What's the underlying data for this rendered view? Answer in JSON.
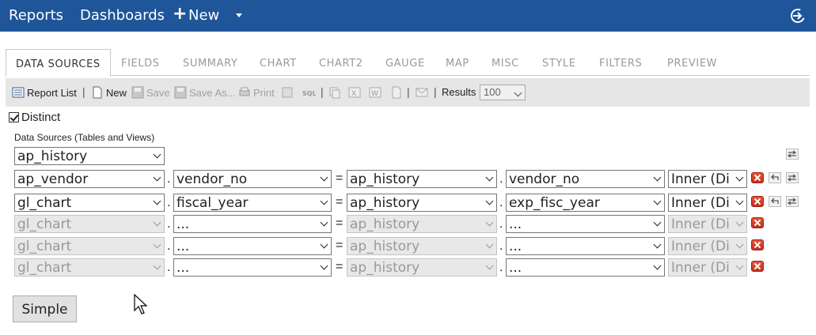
{
  "nav": {
    "reports": "Reports",
    "dashboards": "Dashboards",
    "new_label": "New",
    "brand_color": "#1f5599"
  },
  "tabs": [
    {
      "label": "DATA SOURCES",
      "active": true
    },
    {
      "label": "FIELDS"
    },
    {
      "label": "SUMMARY"
    },
    {
      "label": "CHART"
    },
    {
      "label": "CHART2"
    },
    {
      "label": "GAUGE"
    },
    {
      "label": "MAP"
    },
    {
      "label": "MISC"
    },
    {
      "label": "STYLE"
    },
    {
      "label": "FILTERS"
    },
    {
      "label": "PREVIEW"
    }
  ],
  "toolbar": {
    "report_list": "Report List",
    "new": "New",
    "save": "Save",
    "save_as": "Save As...",
    "print": "Print",
    "results_label": "Results",
    "results_value": "100"
  },
  "distinct": {
    "label": "Distinct",
    "checked": true
  },
  "data_sources_label": "Data Sources (Tables and Views)",
  "primary_table": "ap_history",
  "joins": [
    {
      "table": "ap_vendor",
      "field": "vendor_no",
      "join_table": "ap_history",
      "join_field": "vendor_no",
      "type": "Inner (Di",
      "disabled": false
    },
    {
      "table": "gl_chart",
      "field": "fiscal_year",
      "join_table": "ap_history",
      "join_field": "exp_fisc_year",
      "type": "Inner (Di",
      "disabled": false
    },
    {
      "table": "gl_chart",
      "field": "...",
      "join_table": "ap_history",
      "join_field": "...",
      "type": "Inner (Di",
      "disabled": true
    },
    {
      "table": "gl_chart",
      "field": "...",
      "join_table": "ap_history",
      "join_field": "...",
      "type": "Inner (Di",
      "disabled": true
    },
    {
      "table": "gl_chart",
      "field": "...",
      "join_table": "ap_history",
      "join_field": "...",
      "type": "Inner (Di",
      "disabled": true
    }
  ],
  "simple_button": "Simple"
}
